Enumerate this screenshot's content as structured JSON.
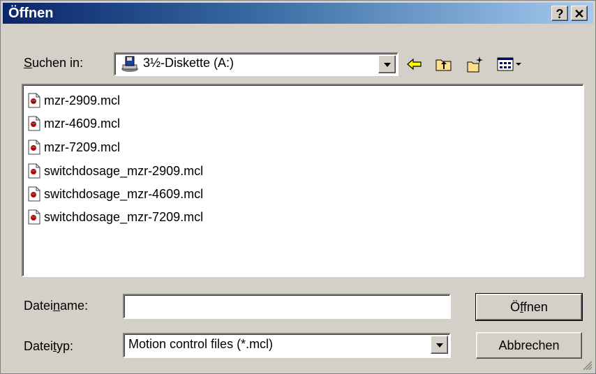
{
  "window": {
    "title": "Öffnen",
    "help_label": "?",
    "close_label": "✕"
  },
  "lookin": {
    "label_pre": "",
    "label_accel": "S",
    "label_post": "uchen in:",
    "value": "3½-Diskette (A:)"
  },
  "toolbar": {
    "back_icon": "back-arrow-icon",
    "up_icon": "up-folder-icon",
    "newfolder_icon": "new-folder-icon",
    "view_icon": "view-menu-icon"
  },
  "files": [
    {
      "name": "mzr-2909.mcl"
    },
    {
      "name": "mzr-4609.mcl"
    },
    {
      "name": "mzr-7209.mcl"
    },
    {
      "name": "switchdosage_mzr-2909.mcl"
    },
    {
      "name": "switchdosage_mzr-4609.mcl"
    },
    {
      "name": "switchdosage_mzr-7209.mcl"
    }
  ],
  "filename": {
    "label_pre": "Datei",
    "label_accel": "n",
    "label_post": "ame:",
    "value": ""
  },
  "filetype": {
    "label_pre": "Datei",
    "label_accel": "t",
    "label_post": "yp:",
    "value": "Motion control files (*.mcl)"
  },
  "buttons": {
    "open_pre": "Ö",
    "open_accel": "f",
    "open_post": "fnen",
    "cancel": "Abbrechen"
  },
  "colors": {
    "title_start": "#0a246a",
    "title_end": "#a6caf0",
    "face": "#d4d0c8"
  }
}
